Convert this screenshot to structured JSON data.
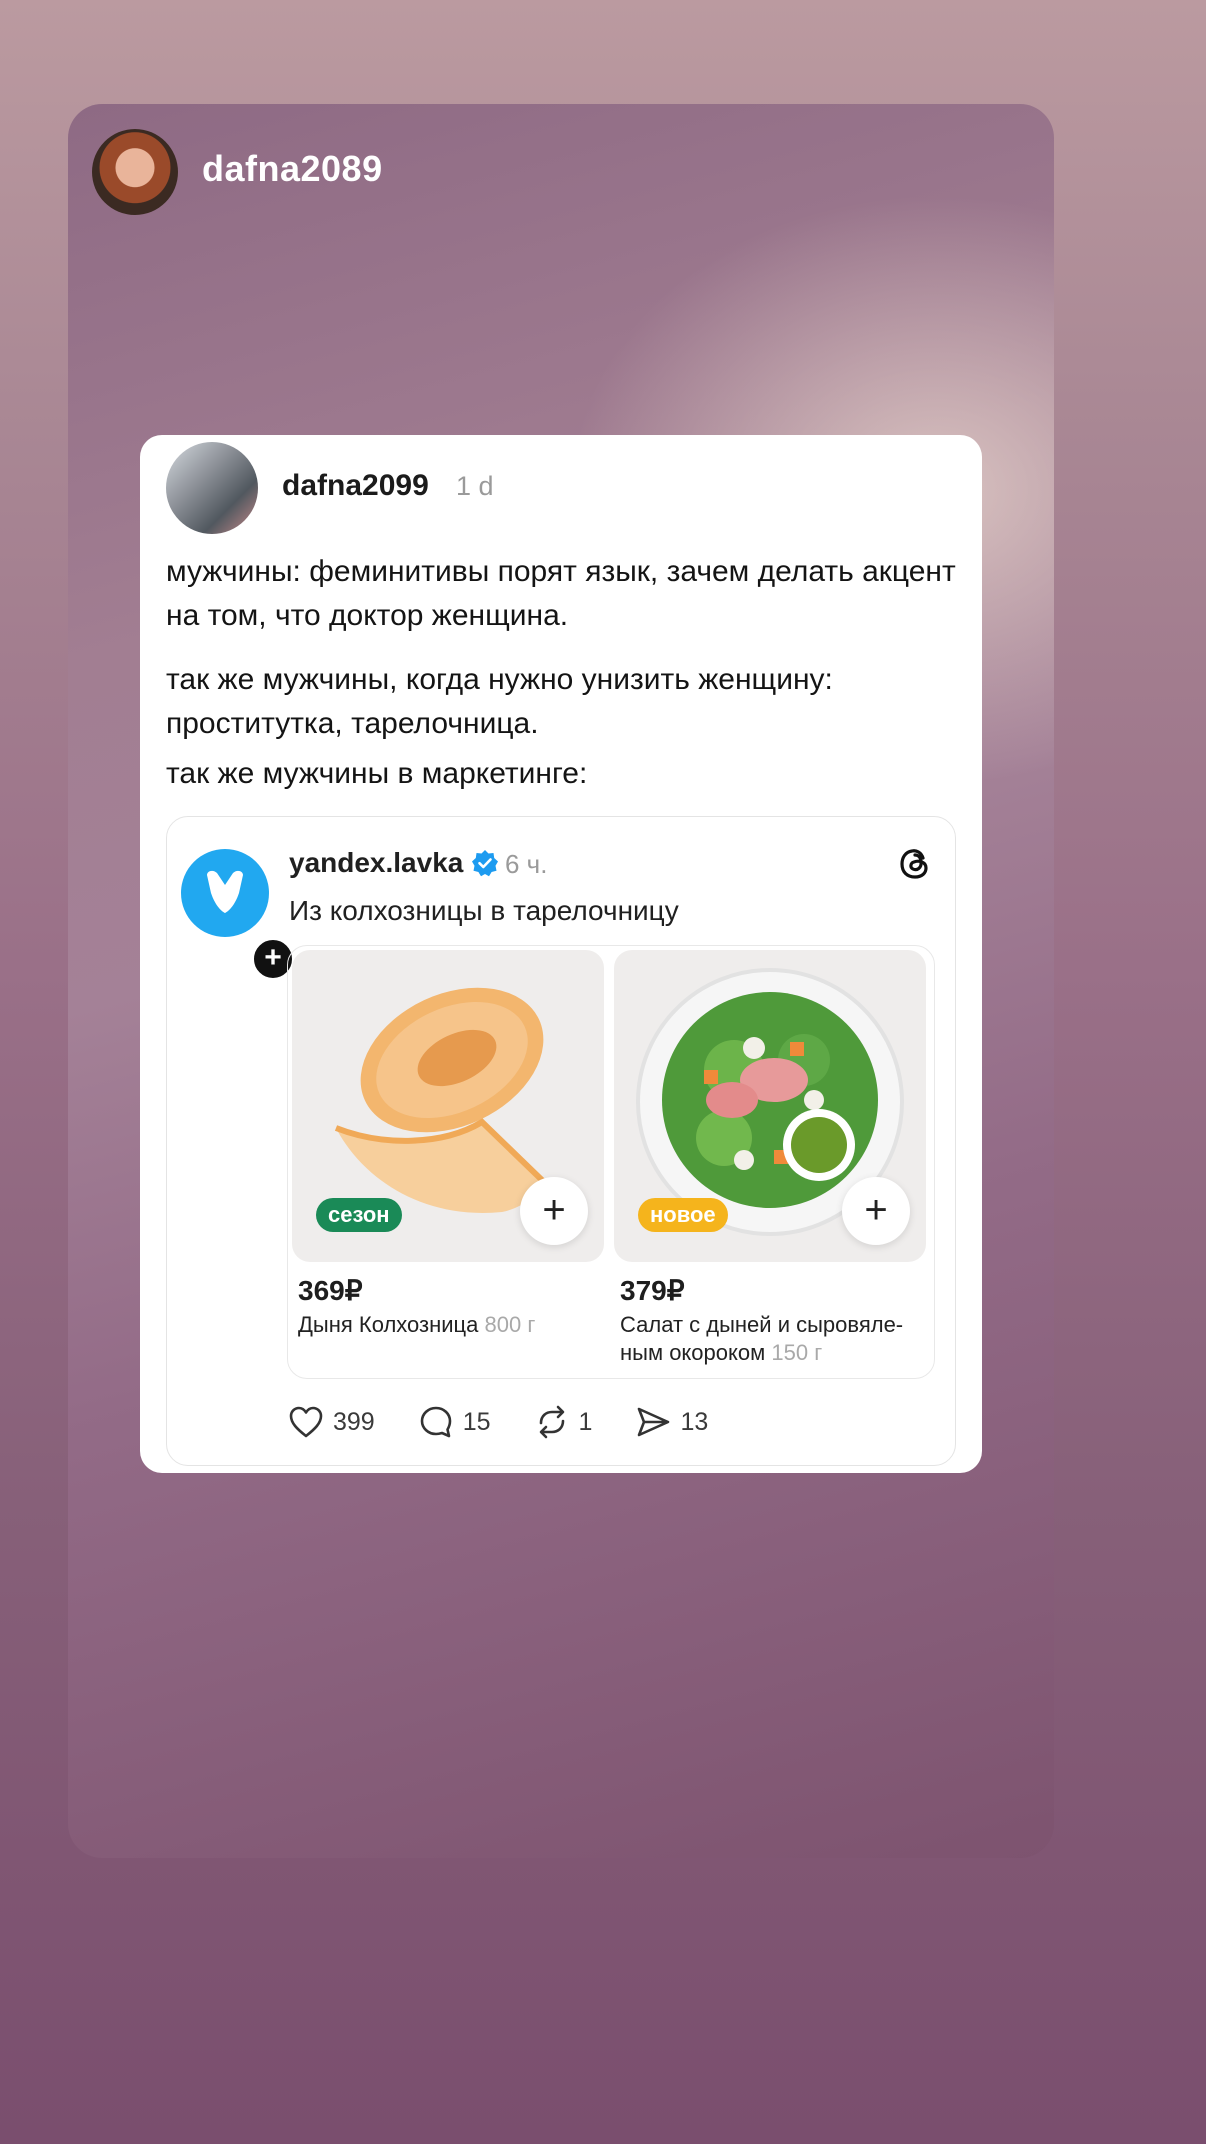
{
  "story": {
    "username": "dafna2089"
  },
  "post": {
    "username": "dafna2099",
    "time": "1 d",
    "paragraphs": [
      "мужчины: феминитивы порят язык, зачем делать акцент на том, что доктор женщина.",
      "так же мужчины, когда нужно унизить женщину: проститутка, тарелочница.",
      "так же мужчины в маркетинге:"
    ]
  },
  "quoted_post": {
    "username": "yandex.lavka",
    "time": "6 ч.",
    "text": "Из колхозницы в тарелочницу",
    "products": [
      {
        "badge": "сезон",
        "badge_color": "#1a8a57",
        "price": "369₽",
        "name": "Дыня Колхозница",
        "weight": "800 г"
      },
      {
        "badge": "новое",
        "badge_color": "#f5b41c",
        "price": "379₽",
        "name": "Салат с дыней и сыровяле-ным окороком",
        "weight": "150 г"
      }
    ],
    "actions": {
      "likes": "399",
      "comments": "15",
      "reposts": "1",
      "shares": "13"
    }
  },
  "colors": {
    "avatar_blue": "#21a8f0",
    "verified_blue": "#1d9bf0"
  }
}
